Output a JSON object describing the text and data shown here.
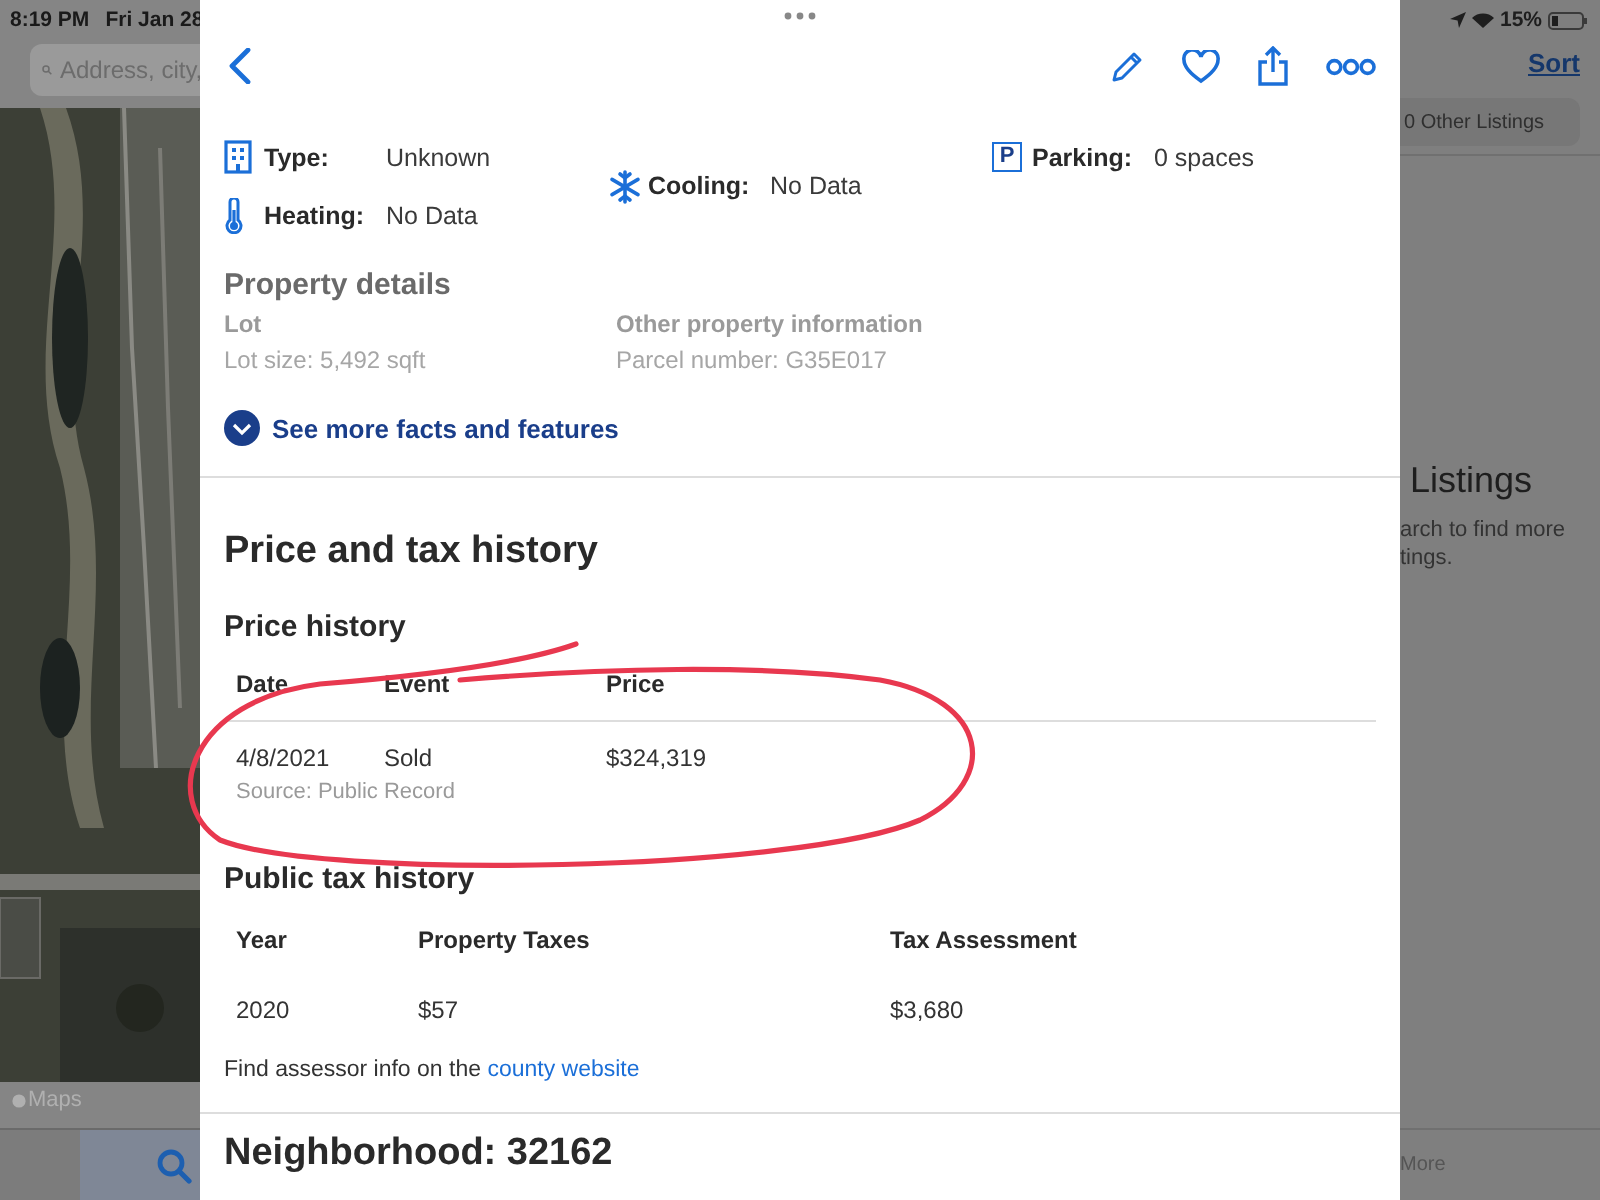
{
  "status_bar": {
    "time": "8:19 PM",
    "date": "Fri Jan 28",
    "battery": "15%"
  },
  "map_panel": {
    "search_placeholder": "Address, city,",
    "attribution": "Maps"
  },
  "detail_sheet": {
    "fact_columns": [
      [
        {
          "kind": "building",
          "label": "Type:",
          "value": "Unknown"
        },
        {
          "kind": "thermometer",
          "label": "Heating:",
          "value": "No Data"
        }
      ],
      [
        {
          "kind": "snowflake",
          "label": "Cooling:",
          "value": "No Data"
        }
      ],
      [
        {
          "kind": "parking",
          "badge": "P",
          "label": "Parking:",
          "value": "0 spaces"
        }
      ]
    ],
    "property_details": {
      "title": "Property details",
      "groups": [
        {
          "title": "Lot",
          "value": "Lot size: 5,492 sqft"
        },
        {
          "title": "Other property information",
          "value": "Parcel number: G35E017"
        }
      ]
    },
    "see_more": "See more facts and features",
    "price_tax": {
      "title": "Price and tax history",
      "price_history": {
        "title": "Price history",
        "columns": [
          "Date",
          "Event",
          "Price"
        ],
        "rows": [
          {
            "cells": [
              "4/8/2021",
              "Sold",
              "$324,319"
            ],
            "source": "Source: Public Record"
          }
        ]
      },
      "tax_history": {
        "title": "Public tax history",
        "columns": [
          "Year",
          "Property Taxes",
          "Tax Assessment"
        ],
        "rows": [
          [
            "2020",
            "$57",
            "$3,680"
          ]
        ]
      },
      "assessor_note": {
        "text": "Find assessor info on the",
        "link": "county website"
      }
    },
    "neighborhood_title": "Neighborhood: 32162"
  },
  "listings_panel": {
    "sort": "Sort",
    "other_listings": "0 Other Listings",
    "title": "Listings",
    "message_lines": [
      "arch to find more",
      "tings."
    ],
    "tab": "More"
  }
}
